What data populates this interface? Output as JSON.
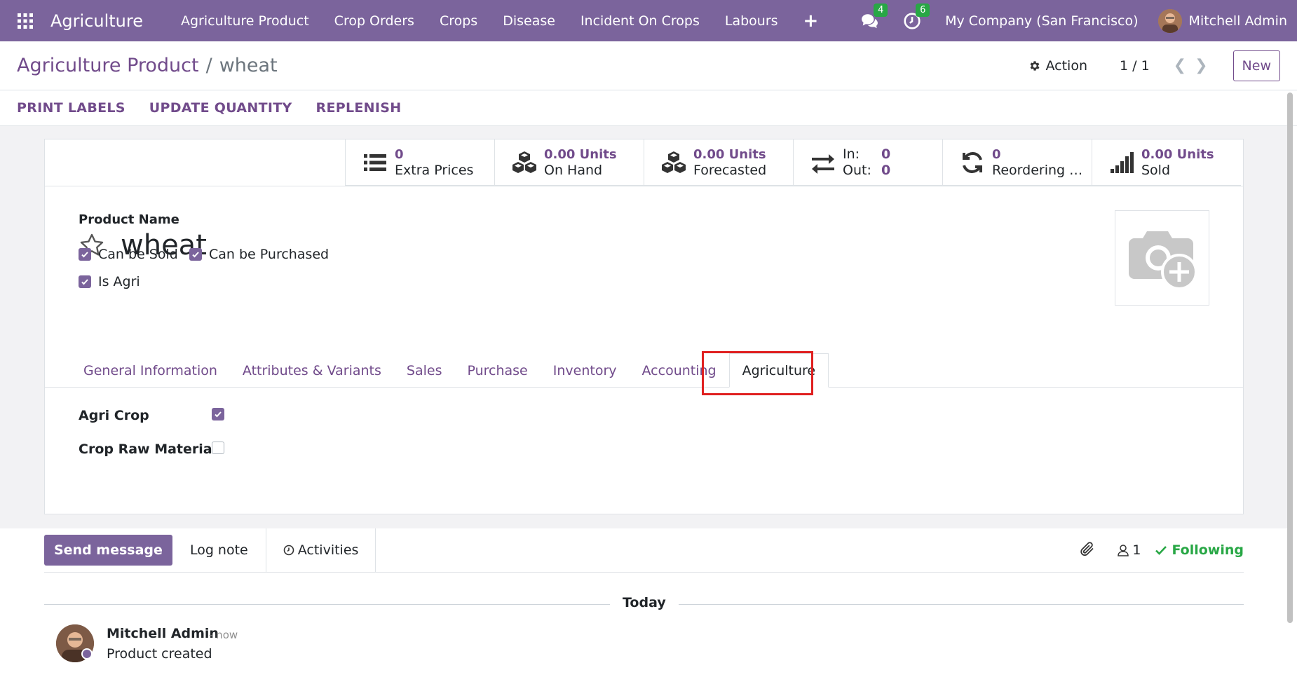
{
  "navbar": {
    "brand": "Agriculture",
    "menu": [
      "Agriculture Product",
      "Crop Orders",
      "Crops",
      "Disease",
      "Incident On Crops",
      "Labours"
    ],
    "plus": "+",
    "messages_count": "4",
    "activities_count": "6",
    "company": "My Company (San Francisco)",
    "user": "Mitchell Admin"
  },
  "control_panel": {
    "breadcrumb_parent": "Agriculture Product",
    "breadcrumb_sep": "/",
    "breadcrumb_current": "wheat",
    "action_label": "Action",
    "pager": "1 / 1",
    "new_label": "New"
  },
  "statusbar": {
    "print_labels": "PRINT LABELS",
    "update_quantity": "UPDATE QUANTITY",
    "replenish": "REPLENISH"
  },
  "smart_buttons": {
    "extra_prices": {
      "value": "0",
      "label": "Extra Prices"
    },
    "on_hand": {
      "value": "0.00 Units",
      "label": "On Hand"
    },
    "forecasted": {
      "value": "0.00 Units",
      "label": "Forecasted"
    },
    "in_out": {
      "in_label": "In:",
      "in_value": "0",
      "out_label": "Out:",
      "out_value": "0"
    },
    "reordering": {
      "value": "0",
      "label": "Reordering Rules"
    },
    "sold": {
      "value": "0.00 Units",
      "label": "Sold"
    }
  },
  "form": {
    "product_name_label": "Product Name",
    "product_name": "wheat",
    "can_be_sold": "Can be Sold",
    "can_be_purchased": "Can be Purchased",
    "is_agri": "Is Agri"
  },
  "tabs": [
    "General Information",
    "Attributes & Variants",
    "Sales",
    "Purchase",
    "Inventory",
    "Accounting",
    "Agriculture"
  ],
  "agriculture_tab": {
    "agri_crop_label": "Agri Crop",
    "agri_crop_checked": true,
    "crop_raw_material_label": "Crop Raw Material",
    "crop_raw_material_checked": false
  },
  "chatter": {
    "send_message": "Send message",
    "log_note": "Log note",
    "activities": "Activities",
    "followers_count": "1",
    "following": "Following",
    "today": "Today",
    "message": {
      "author": "Mitchell Admin",
      "time": "- now",
      "body": "Product created"
    }
  },
  "colors": {
    "brand": "#7b649c",
    "link": "#714b8b",
    "success": "#28a745",
    "highlight": "#e02020"
  }
}
